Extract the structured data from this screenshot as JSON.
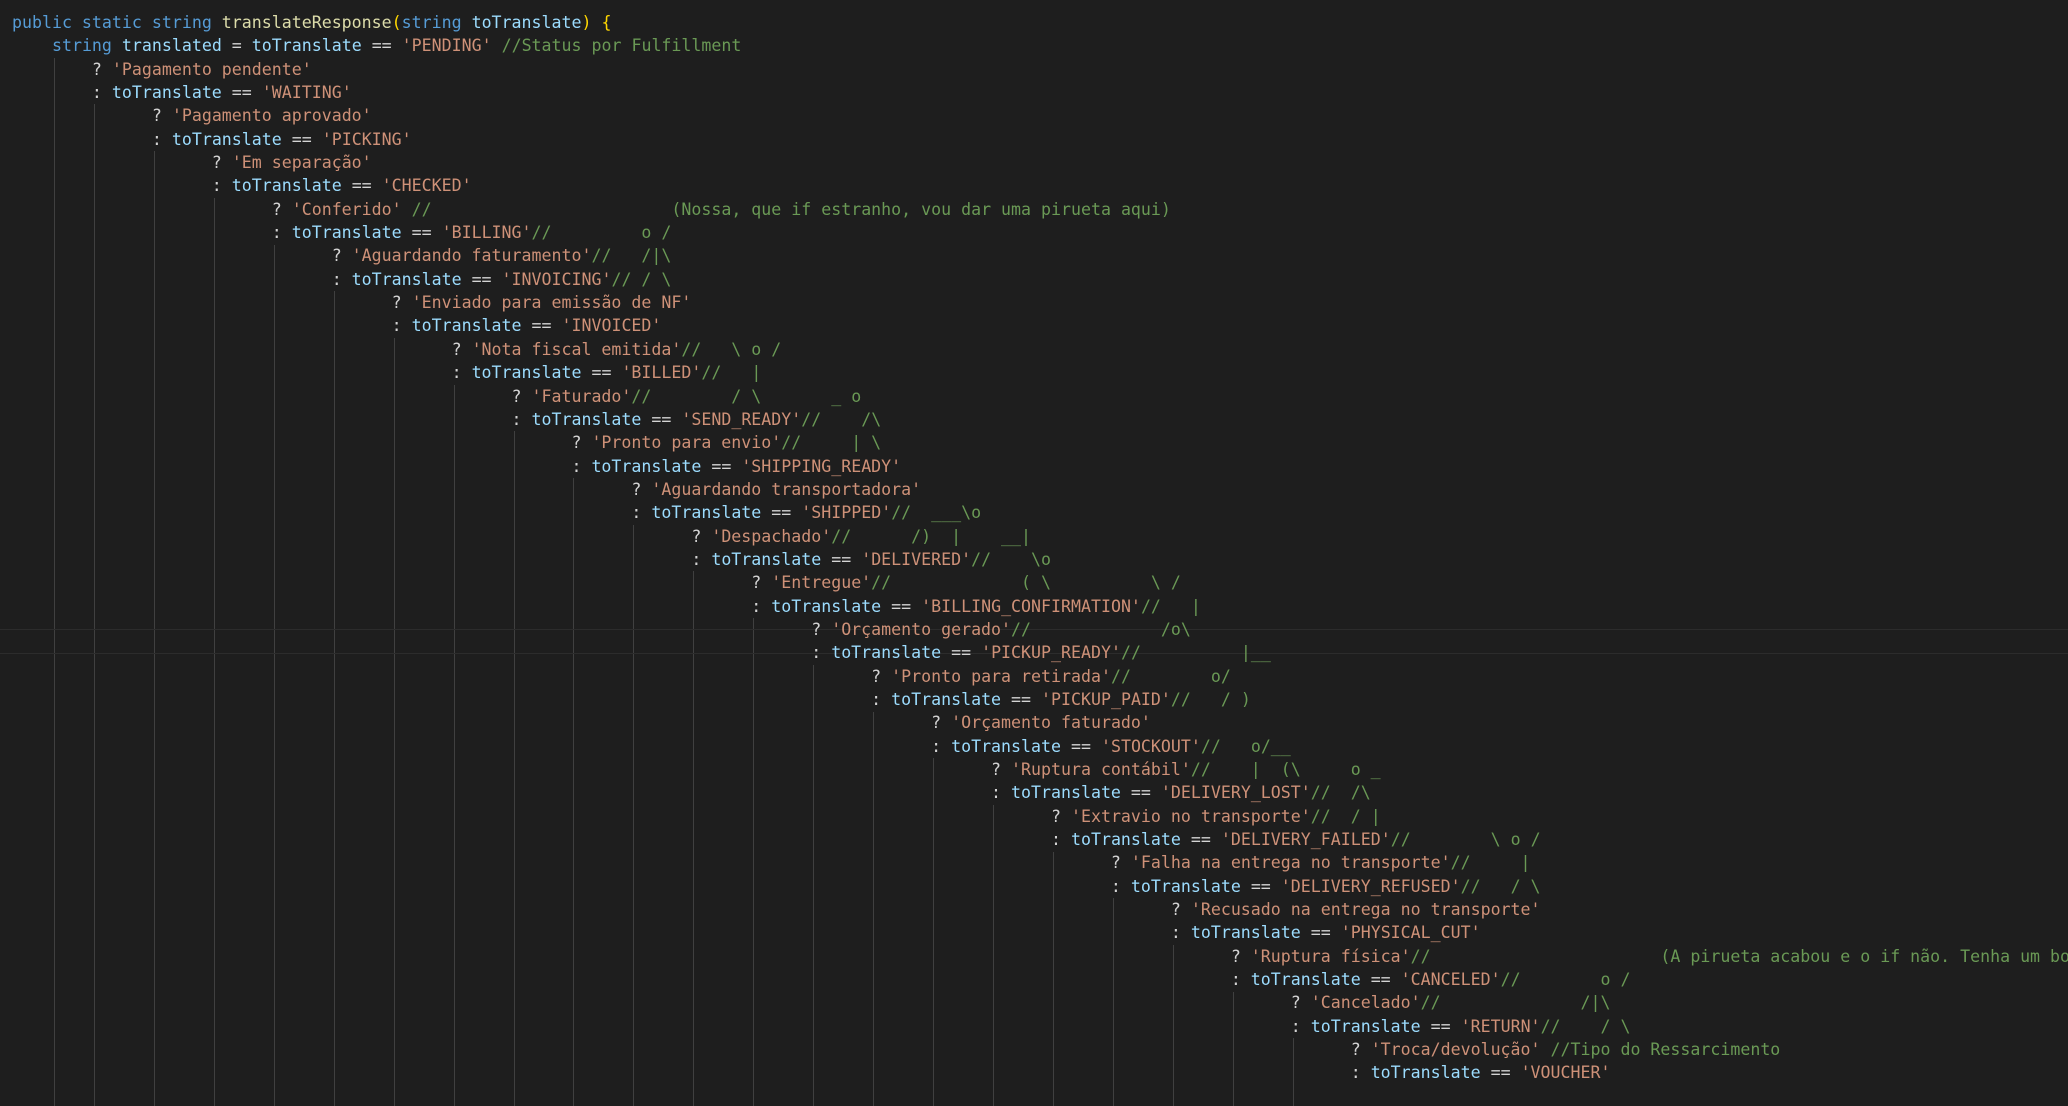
{
  "editor": {
    "language": "csharp",
    "theme_colors": {
      "background": "#1e1e1e",
      "keyword": "#569cd6",
      "function": "#dcdcaa",
      "variable": "#9cdcfe",
      "string": "#ce9178",
      "comment": "#6a9955",
      "text": "#d4d4d4",
      "indent_guide": "#404040"
    },
    "lines": [
      [
        {
          "t": "kw",
          "v": "public static string "
        },
        {
          "t": "fn",
          "v": "translateResponse"
        },
        {
          "t": "br",
          "v": "("
        },
        {
          "t": "kw",
          "v": "string "
        },
        {
          "t": "var",
          "v": "toTranslate"
        },
        {
          "t": "br",
          "v": ") {"
        }
      ],
      [
        {
          "t": "op",
          "v": "    "
        },
        {
          "t": "kw",
          "v": "string "
        },
        {
          "t": "var",
          "v": "translated"
        },
        {
          "t": "op",
          "v": " = "
        },
        {
          "t": "var",
          "v": "toTranslate"
        },
        {
          "t": "op",
          "v": " == "
        },
        {
          "t": "str",
          "v": "'PENDING'"
        },
        {
          "t": "cm",
          "v": " //Status por Fulfillment"
        }
      ],
      [
        {
          "t": "op",
          "v": "        ? "
        },
        {
          "t": "str",
          "v": "'Pagamento pendente'"
        }
      ],
      [
        {
          "t": "op",
          "v": "        : "
        },
        {
          "t": "var",
          "v": "toTranslate"
        },
        {
          "t": "op",
          "v": " == "
        },
        {
          "t": "str",
          "v": "'WAITING'"
        }
      ],
      [
        {
          "t": "op",
          "v": "              ? "
        },
        {
          "t": "str",
          "v": "'Pagamento aprovado'"
        }
      ],
      [
        {
          "t": "op",
          "v": "              : "
        },
        {
          "t": "var",
          "v": "toTranslate"
        },
        {
          "t": "op",
          "v": " == "
        },
        {
          "t": "str",
          "v": "'PICKING'"
        }
      ],
      [
        {
          "t": "op",
          "v": "                    ? "
        },
        {
          "t": "str",
          "v": "'Em separação'"
        }
      ],
      [
        {
          "t": "op",
          "v": "                    : "
        },
        {
          "t": "var",
          "v": "toTranslate"
        },
        {
          "t": "op",
          "v": " == "
        },
        {
          "t": "str",
          "v": "'CHECKED'"
        }
      ],
      [
        {
          "t": "op",
          "v": "                          ? "
        },
        {
          "t": "str",
          "v": "'Conferido'"
        },
        {
          "t": "cm",
          "v": " //                        (Nossa, que if estranho, vou dar uma pirueta aqui)"
        }
      ],
      [
        {
          "t": "op",
          "v": "                          : "
        },
        {
          "t": "var",
          "v": "toTranslate"
        },
        {
          "t": "op",
          "v": " == "
        },
        {
          "t": "str",
          "v": "'BILLING'"
        },
        {
          "t": "cm",
          "v": "//         o /"
        }
      ],
      [
        {
          "t": "op",
          "v": "                                ? "
        },
        {
          "t": "str",
          "v": "'Aguardando faturamento'"
        },
        {
          "t": "cm",
          "v": "//   /|\\"
        }
      ],
      [
        {
          "t": "op",
          "v": "                                : "
        },
        {
          "t": "var",
          "v": "toTranslate"
        },
        {
          "t": "op",
          "v": " == "
        },
        {
          "t": "str",
          "v": "'INVOICING'"
        },
        {
          "t": "cm",
          "v": "// / \\"
        }
      ],
      [
        {
          "t": "op",
          "v": "                                      ? "
        },
        {
          "t": "str",
          "v": "'Enviado para emissão de NF'"
        }
      ],
      [
        {
          "t": "op",
          "v": "                                      : "
        },
        {
          "t": "var",
          "v": "toTranslate"
        },
        {
          "t": "op",
          "v": " == "
        },
        {
          "t": "str",
          "v": "'INVOICED'"
        }
      ],
      [
        {
          "t": "op",
          "v": "                                            ? "
        },
        {
          "t": "str",
          "v": "'Nota fiscal emitida'"
        },
        {
          "t": "cm",
          "v": "//   \\ o /"
        }
      ],
      [
        {
          "t": "op",
          "v": "                                            : "
        },
        {
          "t": "var",
          "v": "toTranslate"
        },
        {
          "t": "op",
          "v": " == "
        },
        {
          "t": "str",
          "v": "'BILLED'"
        },
        {
          "t": "cm",
          "v": "//   |"
        }
      ],
      [
        {
          "t": "op",
          "v": "                                                  ? "
        },
        {
          "t": "str",
          "v": "'Faturado'"
        },
        {
          "t": "cm",
          "v": "//        / \\       _ o"
        }
      ],
      [
        {
          "t": "op",
          "v": "                                                  : "
        },
        {
          "t": "var",
          "v": "toTranslate"
        },
        {
          "t": "op",
          "v": " == "
        },
        {
          "t": "str",
          "v": "'SEND_READY'"
        },
        {
          "t": "cm",
          "v": "//    /\\"
        }
      ],
      [
        {
          "t": "op",
          "v": "                                                        ? "
        },
        {
          "t": "str",
          "v": "'Pronto para envio'"
        },
        {
          "t": "cm",
          "v": "//     | \\"
        }
      ],
      [
        {
          "t": "op",
          "v": "                                                        : "
        },
        {
          "t": "var",
          "v": "toTranslate"
        },
        {
          "t": "op",
          "v": " == "
        },
        {
          "t": "str",
          "v": "'SHIPPING_READY'"
        }
      ],
      [
        {
          "t": "op",
          "v": "                                                              ? "
        },
        {
          "t": "str",
          "v": "'Aguardando transportadora'"
        }
      ],
      [
        {
          "t": "op",
          "v": "                                                              : "
        },
        {
          "t": "var",
          "v": "toTranslate"
        },
        {
          "t": "op",
          "v": " == "
        },
        {
          "t": "str",
          "v": "'SHIPPED'"
        },
        {
          "t": "cm",
          "v": "//  ___\\o"
        }
      ],
      [
        {
          "t": "op",
          "v": "                                                                    ? "
        },
        {
          "t": "str",
          "v": "'Despachado'"
        },
        {
          "t": "cm",
          "v": "//      /)  |    __|"
        }
      ],
      [
        {
          "t": "op",
          "v": "                                                                    : "
        },
        {
          "t": "var",
          "v": "toTranslate"
        },
        {
          "t": "op",
          "v": " == "
        },
        {
          "t": "str",
          "v": "'DELIVERED'"
        },
        {
          "t": "cm",
          "v": "//    \\o"
        }
      ],
      [
        {
          "t": "op",
          "v": "                                                                          ? "
        },
        {
          "t": "str",
          "v": "'Entregue'"
        },
        {
          "t": "cm",
          "v": "//             ( \\          \\ /"
        }
      ],
      [
        {
          "t": "op",
          "v": "                                                                          : "
        },
        {
          "t": "var",
          "v": "toTranslate"
        },
        {
          "t": "op",
          "v": " == "
        },
        {
          "t": "str",
          "v": "'BILLING_CONFIRMATION'"
        },
        {
          "t": "cm",
          "v": "//   |"
        }
      ],
      [
        {
          "t": "op",
          "v": "                                                                                ? "
        },
        {
          "t": "str",
          "v": "'Orçamento gerado'"
        },
        {
          "t": "cm",
          "v": "//             /o\\"
        }
      ],
      [
        {
          "t": "op",
          "v": "                                                                                : "
        },
        {
          "t": "var",
          "v": "toTranslate"
        },
        {
          "t": "op",
          "v": " == "
        },
        {
          "t": "str",
          "v": "'PICKUP_READY'"
        },
        {
          "t": "cm",
          "v": "//          |__"
        }
      ],
      [
        {
          "t": "op",
          "v": "                                                                                      ? "
        },
        {
          "t": "str",
          "v": "'Pronto para retirada'"
        },
        {
          "t": "cm",
          "v": "//        o/"
        }
      ],
      [
        {
          "t": "op",
          "v": "                                                                                      : "
        },
        {
          "t": "var",
          "v": "toTranslate"
        },
        {
          "t": "op",
          "v": " == "
        },
        {
          "t": "str",
          "v": "'PICKUP_PAID'"
        },
        {
          "t": "cm",
          "v": "//   / )"
        }
      ],
      [
        {
          "t": "op",
          "v": "                                                                                            ? "
        },
        {
          "t": "str",
          "v": "'Orçamento faturado'"
        }
      ],
      [
        {
          "t": "op",
          "v": "                                                                                            : "
        },
        {
          "t": "var",
          "v": "toTranslate"
        },
        {
          "t": "op",
          "v": " == "
        },
        {
          "t": "str",
          "v": "'STOCKOUT'"
        },
        {
          "t": "cm",
          "v": "//   o/__"
        }
      ],
      [
        {
          "t": "op",
          "v": "                                                                                                  ? "
        },
        {
          "t": "str",
          "v": "'Ruptura contábil'"
        },
        {
          "t": "cm",
          "v": "//    |  (\\     o _"
        }
      ],
      [
        {
          "t": "op",
          "v": "                                                                                                  : "
        },
        {
          "t": "var",
          "v": "toTranslate"
        },
        {
          "t": "op",
          "v": " == "
        },
        {
          "t": "str",
          "v": "'DELIVERY_LOST'"
        },
        {
          "t": "cm",
          "v": "//  /\\"
        }
      ],
      [
        {
          "t": "op",
          "v": "                                                                                                        ? "
        },
        {
          "t": "str",
          "v": "'Extravio no transporte'"
        },
        {
          "t": "cm",
          "v": "//  / |"
        }
      ],
      [
        {
          "t": "op",
          "v": "                                                                                                        : "
        },
        {
          "t": "var",
          "v": "toTranslate"
        },
        {
          "t": "op",
          "v": " == "
        },
        {
          "t": "str",
          "v": "'DELIVERY_FAILED'"
        },
        {
          "t": "cm",
          "v": "//        \\ o /"
        }
      ],
      [
        {
          "t": "op",
          "v": "                                                                                                              ? "
        },
        {
          "t": "str",
          "v": "'Falha na entrega no transporte'"
        },
        {
          "t": "cm",
          "v": "//     |"
        }
      ],
      [
        {
          "t": "op",
          "v": "                                                                                                              : "
        },
        {
          "t": "var",
          "v": "toTranslate"
        },
        {
          "t": "op",
          "v": " == "
        },
        {
          "t": "str",
          "v": "'DELIVERY_REFUSED'"
        },
        {
          "t": "cm",
          "v": "//   / \\"
        }
      ],
      [
        {
          "t": "op",
          "v": "                                                                                                                    ? "
        },
        {
          "t": "str",
          "v": "'Recusado na entrega no transporte'"
        }
      ],
      [
        {
          "t": "op",
          "v": "                                                                                                                    : "
        },
        {
          "t": "var",
          "v": "toTranslate"
        },
        {
          "t": "op",
          "v": " == "
        },
        {
          "t": "str",
          "v": "'PHYSICAL_CUT'"
        }
      ],
      [
        {
          "t": "op",
          "v": "                                                                                                                          ? "
        },
        {
          "t": "str",
          "v": "'Ruptura física'"
        },
        {
          "t": "cm",
          "v": "//                       (A pirueta acabou e o if não. Tenha um bom dia)"
        }
      ],
      [
        {
          "t": "op",
          "v": "                                                                                                                          : "
        },
        {
          "t": "var",
          "v": "toTranslate"
        },
        {
          "t": "op",
          "v": " == "
        },
        {
          "t": "str",
          "v": "'CANCELED'"
        },
        {
          "t": "cm",
          "v": "//        o /"
        }
      ],
      [
        {
          "t": "op",
          "v": "                                                                                                                                ? "
        },
        {
          "t": "str",
          "v": "'Cancelado'"
        },
        {
          "t": "cm",
          "v": "//              /|\\"
        }
      ],
      [
        {
          "t": "op",
          "v": "                                                                                                                                : "
        },
        {
          "t": "var",
          "v": "toTranslate"
        },
        {
          "t": "op",
          "v": " == "
        },
        {
          "t": "str",
          "v": "'RETURN'"
        },
        {
          "t": "cm",
          "v": "//    / \\"
        }
      ],
      [
        {
          "t": "op",
          "v": "                                                                                                                                      ? "
        },
        {
          "t": "str",
          "v": "'Troca/devolução'"
        },
        {
          "t": "cm",
          "v": " //Tipo do Ressarcimento"
        }
      ],
      [
        {
          "t": "op",
          "v": "                                                                                                                                      : "
        },
        {
          "t": "var",
          "v": "toTranslate"
        },
        {
          "t": "op",
          "v": " == "
        },
        {
          "t": "str",
          "v": "'VOUCHER'"
        }
      ]
    ]
  }
}
